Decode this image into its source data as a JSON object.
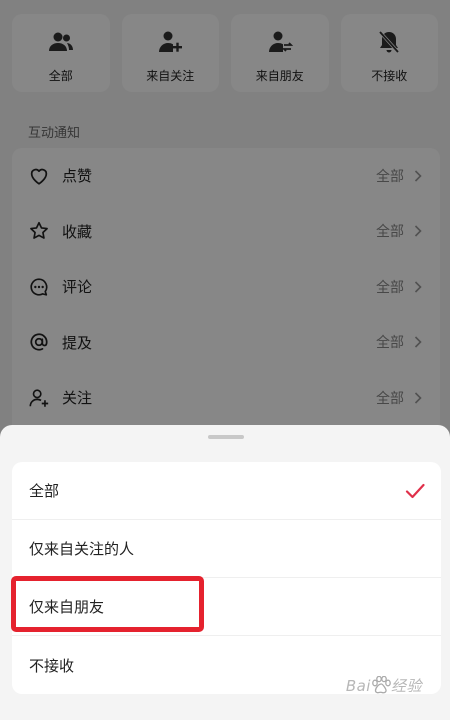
{
  "notification_filters": [
    {
      "label": "全部",
      "icon": "group-icon"
    },
    {
      "label": "来自关注",
      "icon": "person-add-icon"
    },
    {
      "label": "来自朋友",
      "icon": "friends-icon"
    },
    {
      "label": "不接收",
      "icon": "bell-off-icon"
    }
  ],
  "interaction_section": {
    "title": "互动通知",
    "rows": [
      {
        "label": "点赞",
        "value": "全部",
        "icon": "heart-icon"
      },
      {
        "label": "收藏",
        "value": "全部",
        "icon": "star-icon"
      },
      {
        "label": "评论",
        "value": "全部",
        "icon": "comment-icon"
      },
      {
        "label": "提及",
        "value": "全部",
        "icon": "at-icon"
      },
      {
        "label": "关注",
        "value": "全部",
        "icon": "person-add-icon"
      }
    ]
  },
  "sheet": {
    "options": [
      {
        "label": "全部",
        "selected": true
      },
      {
        "label": "仅来自关注的人",
        "selected": false
      },
      {
        "label": "仅来自朋友",
        "selected": false
      },
      {
        "label": "不接收",
        "selected": false
      }
    ]
  },
  "colors": {
    "accent": "#e5222e",
    "check": "#e0304a"
  }
}
